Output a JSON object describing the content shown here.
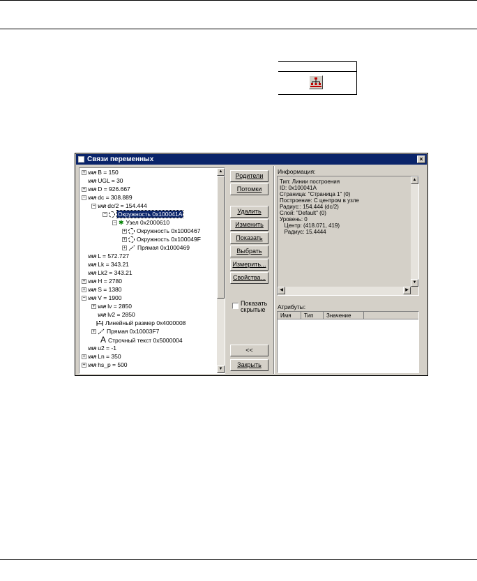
{
  "dialog": {
    "title": "Связи переменных",
    "close_glyph": "×"
  },
  "tree": {
    "rows": [
      {
        "text": "B = 150",
        "expander": "+"
      },
      {
        "text": "UGL = 30",
        "expander": ""
      },
      {
        "text": "D = 926.667",
        "expander": "+"
      },
      {
        "text": "dc = 308.889",
        "expander": "−"
      },
      {
        "text": "dc/2 = 154.444",
        "expander": "−"
      },
      {
        "text": "Окружность 0x100041A",
        "expander": "−"
      },
      {
        "text": "Узел 0x2000610",
        "expander": "−"
      },
      {
        "text": "Окружность 0x1000467",
        "expander": "+"
      },
      {
        "text": "Окружность 0x100049F",
        "expander": "+"
      },
      {
        "text": "Прямая 0x1000469",
        "expander": "+"
      },
      {
        "text": "L = 572.727",
        "expander": ""
      },
      {
        "text": "Lk = 343.21",
        "expander": ""
      },
      {
        "text": "Lk2 = 343.21",
        "expander": ""
      },
      {
        "text": "H = 2780",
        "expander": "+"
      },
      {
        "text": "S = 1380",
        "expander": "+"
      },
      {
        "text": "V = 1900",
        "expander": "−"
      },
      {
        "text": "lv = 2850",
        "expander": "+"
      },
      {
        "text": "lv2 = 2850",
        "expander": ""
      },
      {
        "text": "Линейный размер 0x4000008",
        "expander": ""
      },
      {
        "text": "Прямая 0x10003F7",
        "expander": "+"
      },
      {
        "text": "Строчный текст 0x5000004",
        "expander": ""
      },
      {
        "text": "u2 = -1",
        "expander": ""
      },
      {
        "text": "Ln = 350",
        "expander": "+"
      },
      {
        "text": "hs_p = 500",
        "expander": "+"
      }
    ],
    "var_tag": "VAR"
  },
  "buttons": {
    "parents": "Родители",
    "children": "Потомки",
    "delete": "Удалить",
    "edit": "Изменить",
    "show": "Показать",
    "select": "Выбрать",
    "measure": "Измерить...",
    "properties": "Свойства...",
    "back": "<<",
    "close": "Закрыть"
  },
  "show_hidden": {
    "label_line1": "Показать",
    "label_line2": "скрытые",
    "checked": false
  },
  "info": {
    "label": "Информация:",
    "lines": [
      "Тип: Линии построения",
      "ID: 0x100041A",
      "Страница: \"Страница 1\" (0)",
      "Построение: С центром в узле",
      "Радиус:: 154.444 (dc/2)",
      "Слой: \"Default\" (0)",
      "Уровень: 0",
      "   Центр: (418.071, 419)",
      "   Радиус: 15.4444"
    ]
  },
  "attributes": {
    "label": "Атрибуты:",
    "columns": [
      "Имя",
      "Тип",
      "Значение"
    ]
  }
}
